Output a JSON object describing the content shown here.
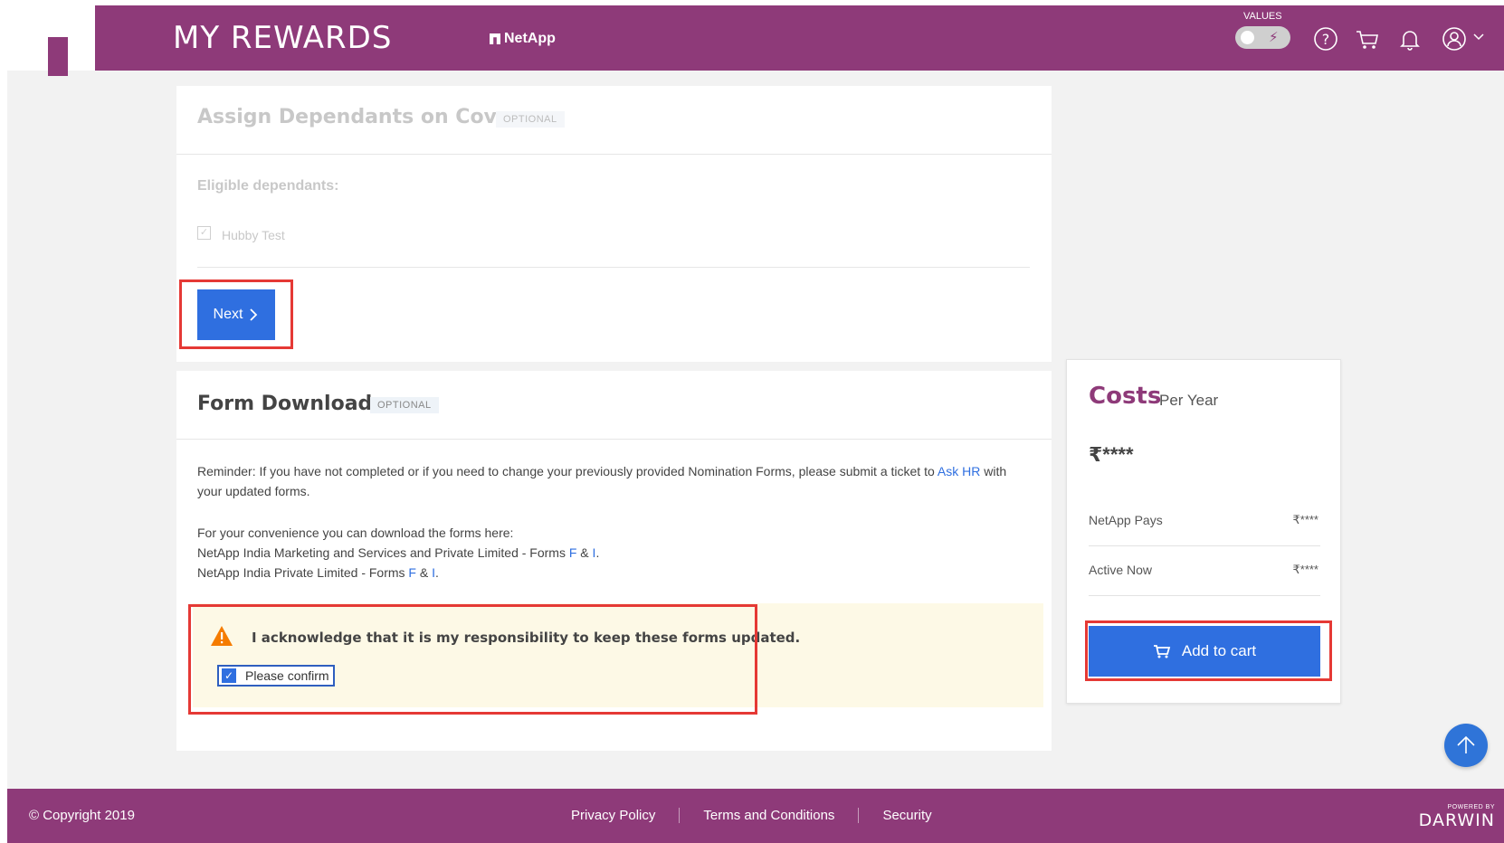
{
  "header": {
    "title": "MY REWARDS",
    "brand": "NetApp",
    "values_label": "VALUES",
    "icons": [
      "help-icon",
      "cart-icon",
      "bell-icon",
      "user-icon"
    ]
  },
  "dependants": {
    "title": "Assign Dependants on Cover",
    "badge": "OPTIONAL",
    "eligible_label": "Eligible dependants:",
    "dependant_name": "Hubby Test",
    "next_label": "Next"
  },
  "form_download": {
    "title": "Form Download",
    "badge": "OPTIONAL",
    "reminder_pre": "Reminder: If you have not completed or if you need to change your previously provided Nomination Forms, please submit a ticket to ",
    "reminder_link": "Ask HR",
    "reminder_post": " with your updated forms.",
    "convenience": "For your convenience you can download the forms here:",
    "line1_pre": "NetApp India Marketing and Services and Private Limited - Forms ",
    "line2_pre": "NetApp India Private Limited - Forms ",
    "form_f": "F",
    "amp": " & ",
    "form_i": "I",
    "period": ".",
    "acknowledge": "I acknowledge that it is my responsibility to keep these forms updated.",
    "confirm_label": "Please confirm",
    "confirm_checked": true
  },
  "costs": {
    "title": "Costs",
    "subtitle": "Per Year",
    "total": "₹****",
    "rows": [
      {
        "label": "NetApp Pays",
        "value": "₹****"
      },
      {
        "label": "Active Now",
        "value": "₹****"
      }
    ],
    "cart_label": "Add to cart"
  },
  "footer": {
    "copyright": "© Copyright 2019",
    "links": [
      "Privacy Policy",
      "Terms and Conditions",
      "Security"
    ],
    "powered_by": "POWERED BY",
    "powered_brand": "DARWIN"
  },
  "colors": {
    "brand": "#8e3a79",
    "accent": "#2f6fe0",
    "highlight": "#e53935"
  }
}
